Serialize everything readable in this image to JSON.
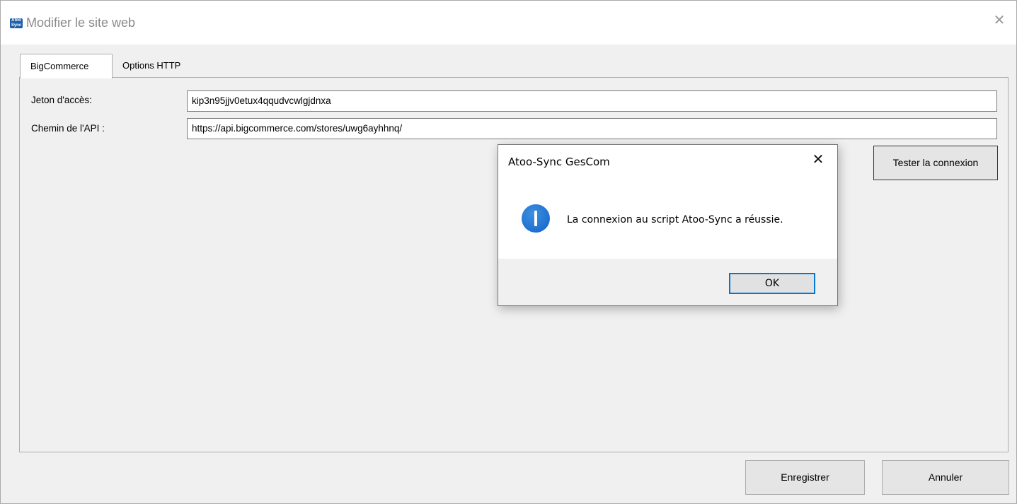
{
  "window": {
    "title": "Modifier le site web",
    "icon": "atoo-sync-app-icon",
    "icon_text_top": "Atoo",
    "icon_text_bottom": "Sync",
    "close_glyph": "✕"
  },
  "tabs": [
    {
      "label": "BigCommerce",
      "active": true
    },
    {
      "label": "Options HTTP",
      "active": false
    }
  ],
  "form": {
    "access_token_label": "Jeton d'accès:",
    "access_token_value": "kip3n95jjv0etux4qqudvcwlgjdnxa",
    "api_path_label": "Chemin de l'API :",
    "api_path_value": "https://api.bigcommerce.com/stores/uwg6ayhhnq/",
    "test_button": "Tester la connexion"
  },
  "footer": {
    "save_button": "Enregistrer",
    "cancel_button": "Annuler"
  },
  "dialog": {
    "title": "Atoo-Sync GesCom",
    "close_glyph": "✕",
    "icon": "info-icon",
    "message": "La connexion au script Atoo-Sync a réussie.",
    "ok_button": "OK"
  },
  "colors": {
    "accent": "#0078d7",
    "info_icon": "#1a6fd1"
  }
}
